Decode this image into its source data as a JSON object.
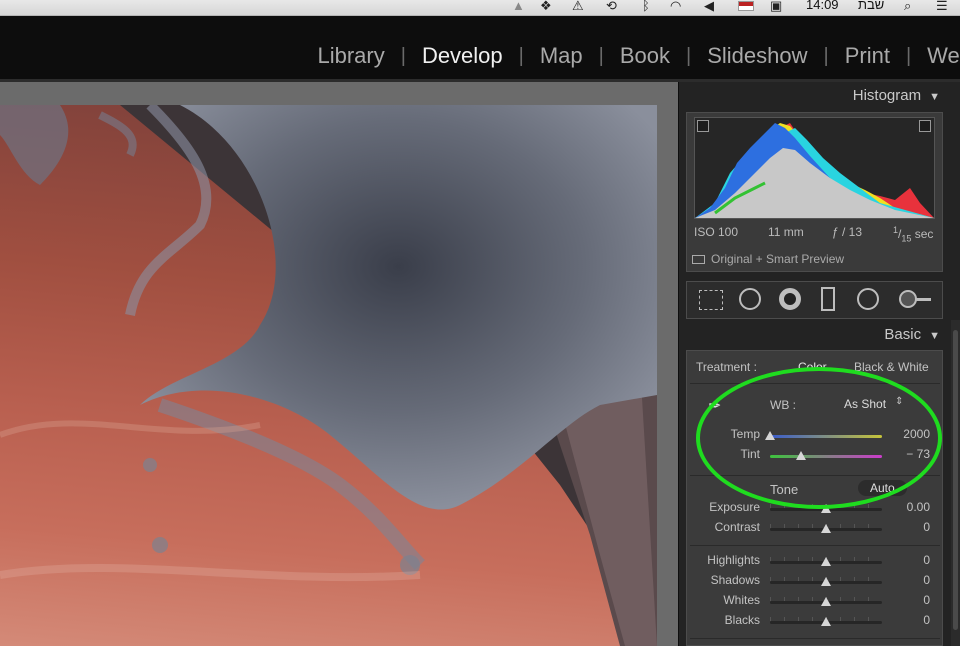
{
  "menubar": {
    "clock": "14:09",
    "day": "שבת",
    "icons": [
      "cloud-upload-icon",
      "dropbox-icon",
      "sync-warning-icon",
      "time-machine-icon",
      "bluetooth-icon",
      "wifi-icon",
      "volume-icon",
      "flag-us-icon",
      "display-icon",
      "spotlight-icon",
      "notifications-icon"
    ]
  },
  "modules": {
    "items": [
      "Library",
      "Develop",
      "Map",
      "Book",
      "Slideshow",
      "Print",
      "Web"
    ],
    "active": "Develop"
  },
  "histogram": {
    "title": "Histogram",
    "iso": "ISO 100",
    "focal": "11 mm",
    "aperture": "ƒ / 13",
    "shutter_num": "1",
    "shutter_den": "15",
    "shutter_unit": "sec",
    "preview": "Original + Smart Preview"
  },
  "tools": [
    "crop-overlay-icon",
    "spot-removal-icon",
    "red-eye-icon",
    "graduated-filter-icon",
    "radial-filter-icon",
    "adjustment-brush-icon"
  ],
  "basic": {
    "title": "Basic",
    "treatment_label": "Treatment :",
    "color_label": "Color",
    "bw_label": "Black & White",
    "wb_label": "WB :",
    "wb_value": "As Shot",
    "tone_label": "Tone",
    "auto_label": "Auto",
    "sliders": [
      {
        "label": "Temp",
        "value": "2000",
        "pos": 0.0
      },
      {
        "label": "Tint",
        "value": "− 73",
        "pos": 0.28
      },
      {
        "label": "Exposure",
        "value": "0.00",
        "pos": 0.5
      },
      {
        "label": "Contrast",
        "value": "0",
        "pos": 0.5
      },
      {
        "label": "Highlights",
        "value": "0",
        "pos": 0.5
      },
      {
        "label": "Shadows",
        "value": "0",
        "pos": 0.5
      },
      {
        "label": "Whites",
        "value": "0",
        "pos": 0.5
      },
      {
        "label": "Blacks",
        "value": "0",
        "pos": 0.5
      }
    ]
  },
  "colors": {
    "accent_annotation": "#1fdc1f",
    "panel_bg": "#3b3b3b",
    "module_active": "#f0f0f0"
  }
}
